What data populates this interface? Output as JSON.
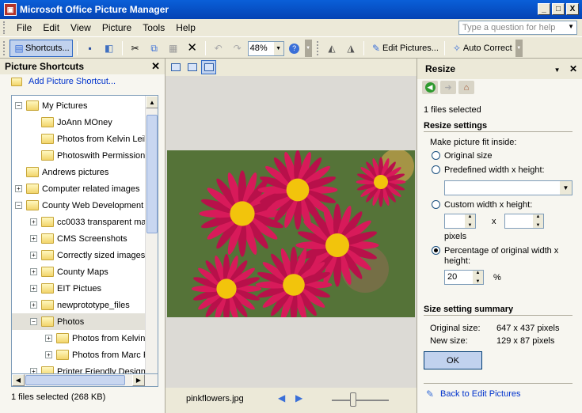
{
  "window": {
    "title": "Microsoft Office Picture Manager",
    "min": "_",
    "max": "□",
    "close": "X"
  },
  "menu": [
    "File",
    "Edit",
    "View",
    "Picture",
    "Tools",
    "Help"
  ],
  "ask_placeholder": "Type a question for help",
  "toolbar": {
    "shortcuts_label": "Shortcuts...",
    "zoom_value": "48%",
    "edit_pictures_label": "Edit Pictures...",
    "auto_correct_label": "Auto Correct"
  },
  "left_pane": {
    "title": "Picture Shortcuts",
    "add_shortcut": "Add Picture Shortcut...",
    "tree": [
      {
        "label": "My Pictures",
        "level": 0,
        "exp": "−"
      },
      {
        "label": "JoAnn MOney",
        "level": 1,
        "exp": ""
      },
      {
        "label": "Photos from Kelvin Leib",
        "level": 1,
        "exp": ""
      },
      {
        "label": "Photoswith Permissions",
        "level": 1,
        "exp": ""
      },
      {
        "label": "Andrews pictures",
        "level": 0,
        "exp": ""
      },
      {
        "label": "Computer related images",
        "level": 0,
        "exp": "+"
      },
      {
        "label": "County Web Development",
        "level": 0,
        "exp": "−"
      },
      {
        "label": "cc0033 transparent ma",
        "level": 1,
        "exp": "+"
      },
      {
        "label": "CMS Screenshots",
        "level": 1,
        "exp": "+"
      },
      {
        "label": "Correctly sized images",
        "level": 1,
        "exp": "+"
      },
      {
        "label": "County Maps",
        "level": 1,
        "exp": "+"
      },
      {
        "label": "EIT Pictues",
        "level": 1,
        "exp": "+"
      },
      {
        "label": "newprototype_files",
        "level": 1,
        "exp": "+"
      },
      {
        "label": "Photos",
        "level": 1,
        "exp": "−"
      },
      {
        "label": "Photos from Kelvin",
        "level": 2,
        "exp": "+"
      },
      {
        "label": "Photos from Marc F",
        "level": 2,
        "exp": "+"
      },
      {
        "label": "Printer Friendly Design",
        "level": 1,
        "exp": "+"
      }
    ],
    "status": "1 files selected (268 KB)"
  },
  "center": {
    "filename": "pinkflowers.jpg"
  },
  "right_pane": {
    "title": "Resize",
    "files_selected": "1 files selected",
    "settings_header": "Resize settings",
    "fit_label": "Make picture fit inside:",
    "opt_original": "Original size",
    "opt_predefined": "Predefined width x height:",
    "opt_custom": "Custom width x height:",
    "x_label": "x",
    "pixels": "pixels",
    "opt_percent_1": "Percentage of original width x",
    "opt_percent_2": "height:",
    "percent_value": "20",
    "percent_sign": "%",
    "summary_header": "Size setting summary",
    "original_label": "Original size:",
    "original_value": "647 x 437 pixels",
    "new_label": "New size:",
    "new_value": "129 x 87 pixels",
    "ok": "OK",
    "back_link": "Back to Edit Pictures"
  },
  "colors": {
    "titlebar": "#0443b4",
    "selection": "#c1d2ee",
    "link": "#0033cc"
  }
}
